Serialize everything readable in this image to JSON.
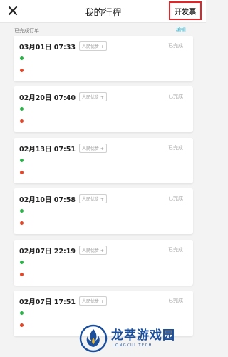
{
  "header": {
    "title": "我的行程",
    "invoice_label": "开发票"
  },
  "section": {
    "label": "已完成订单",
    "edit_label": "编辑"
  },
  "trips": [
    {
      "time": "03月01日 07:33",
      "tag": "人民优步 +",
      "status": "已完成"
    },
    {
      "time": "02月20日 07:40",
      "tag": "人民优步 +",
      "status": "已完成"
    },
    {
      "time": "02月13日 07:51",
      "tag": "人民优步 +",
      "status": "已完成"
    },
    {
      "time": "02月10日 07:58",
      "tag": "人民优步 +",
      "status": "已完成"
    },
    {
      "time": "02月07日 22:19",
      "tag": "人民优步 +",
      "status": "已完成"
    },
    {
      "time": "02月07日 17:51",
      "tag": "人民优步 +",
      "status": "已完成"
    }
  ],
  "watermark": {
    "name": "龙萃游戏园",
    "sub": "LONGCUI TECH"
  },
  "colors": {
    "highlight_border": "#e0252b",
    "edit_link": "#3ab0c9",
    "start_dot": "#2bb34a",
    "end_dot": "#e2472a",
    "watermark": "#1b4f9c"
  },
  "icons": {
    "close": "close-icon",
    "logo": "flame-logo-icon"
  }
}
